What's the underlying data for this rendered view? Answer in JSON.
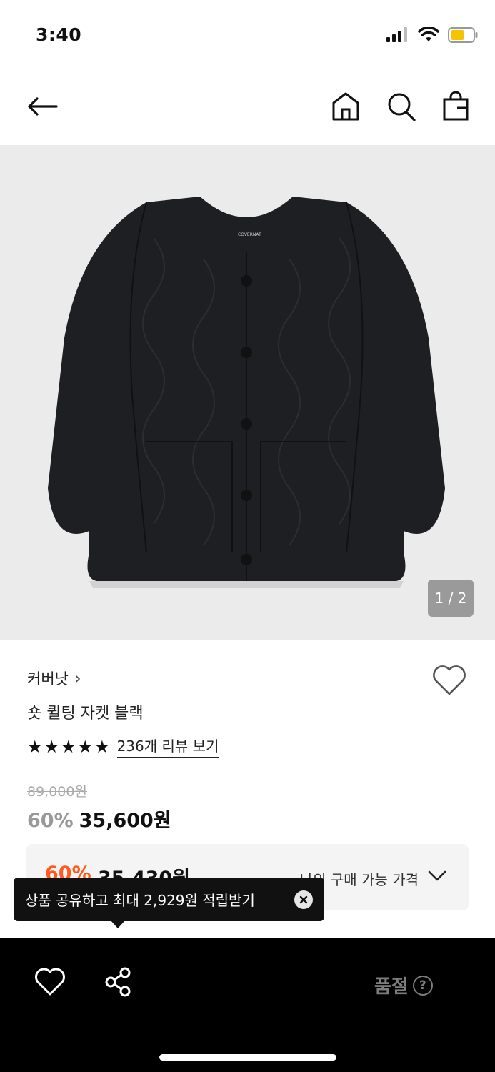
{
  "status_bar": {
    "time": "3:40"
  },
  "product": {
    "brand": "커버낫",
    "brand_chevron": "›",
    "name": "숏 퀼팅 자켓 블랙",
    "image_counter": "1 / 2",
    "jacket_logo": "COVERNAT",
    "rating": {
      "stars": 5,
      "review_link": "236개 리뷰 보기"
    },
    "original_price": "89,000원",
    "discount_rate": "60%",
    "sale_price": "35,600원"
  },
  "my_price": {
    "discount_rate": "60%",
    "price": "35,430원",
    "label": "나의 구매 가능 가격"
  },
  "tooltip": {
    "text": "상품 공유하고 최대 2,929원 적립받기"
  },
  "bottom_bar": {
    "soldout_label": "품절",
    "help_symbol": "?"
  },
  "colors": {
    "accent_discount": "#ff5a1f",
    "bottom_bar_bg": "#000000",
    "image_bg": "#ebebeb"
  }
}
